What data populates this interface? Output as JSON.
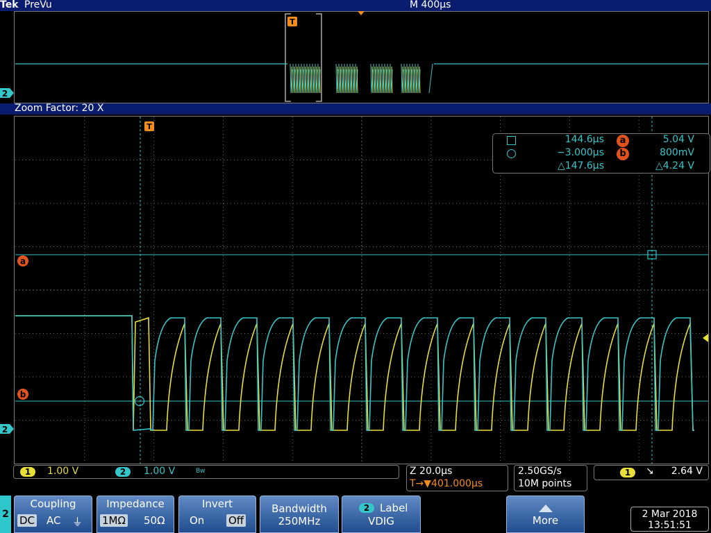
{
  "header": {
    "brand": "Tek",
    "mode": "PreVu",
    "timebase": "M 400µs"
  },
  "preview": {
    "trigger_marker": "T",
    "ch2_marker": "2"
  },
  "zoom": {
    "label": "Zoom Factor: 20 X",
    "trigger_marker": "T"
  },
  "markers": {
    "a": "a",
    "b": "b",
    "ch2": "2"
  },
  "readout": {
    "cursor1_time": "144.6µs",
    "cursor2_time": "−3.000µs",
    "delta_time": "△147.6µs",
    "a_label": "a",
    "a_value": "5.04 V",
    "b_label": "b",
    "b_value": "800mV",
    "delta_v": "△4.24 V"
  },
  "channels": {
    "ch1": {
      "num": "1",
      "scale": "1.00 V",
      "color": "#e9de3a"
    },
    "ch2": {
      "num": "2",
      "scale": "1.00 V",
      "bw": "Bw",
      "color": "#35c6c9"
    }
  },
  "horizontal": {
    "zoom_scale": "Z 20.0µs",
    "trigger_pos": "T→▼401.000µs"
  },
  "sampling": {
    "rate": "2.50GS/s",
    "points": "10M points"
  },
  "trigger": {
    "source": "1",
    "slope": "↘",
    "level": "2.64 V"
  },
  "menu": {
    "channel": "2",
    "coupling": {
      "title": "Coupling",
      "options": [
        "DC",
        "AC",
        "⏚"
      ],
      "selected": "DC"
    },
    "impedance": {
      "title": "Impedance",
      "options": [
        "1MΩ",
        "50Ω"
      ],
      "selected": "1MΩ"
    },
    "invert": {
      "title": "Invert",
      "options": [
        "On",
        "Off"
      ],
      "selected": "Off"
    },
    "bandwidth": {
      "title": "Bandwidth",
      "value": "250MHz"
    },
    "label": {
      "num": "2",
      "title": "Label",
      "value": "VDIG"
    },
    "more": {
      "title": "More"
    }
  },
  "datetime": {
    "date": "2 Mar 2018",
    "time": "13:51:51"
  }
}
